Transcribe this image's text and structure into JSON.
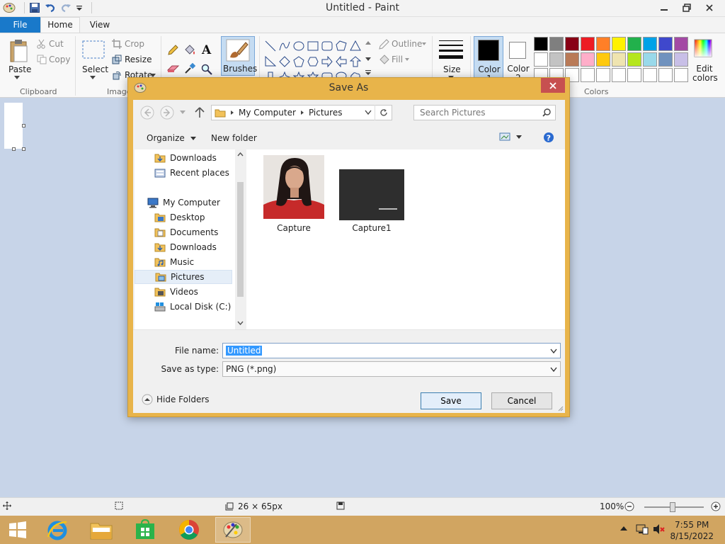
{
  "app": {
    "title": "Untitled - Paint",
    "tabs": {
      "file": "File",
      "home": "Home",
      "view": "View"
    }
  },
  "ribbon": {
    "clipboard": {
      "paste": "Paste",
      "cut": "Cut",
      "copy": "Copy",
      "group": "Clipboard"
    },
    "image": {
      "select": "Select",
      "crop": "Crop",
      "resize": "Resize",
      "rotate": "Rotate",
      "group": "Image"
    },
    "brushes": "Brushes",
    "shapes": {
      "outline": "Outline",
      "fill": "Fill"
    },
    "size": "Size",
    "color1": "Color 1",
    "color2": "Color 2",
    "edit_colors": "Edit colors",
    "colors_group": "Colors",
    "palette_row1": [
      "#000000",
      "#7f7f7f",
      "#880015",
      "#ed1c24",
      "#ff7f27",
      "#fff200",
      "#22b14c",
      "#00a2e8",
      "#3f48cc",
      "#a349a4"
    ],
    "palette_row2": [
      "#ffffff",
      "#c3c3c3",
      "#b97a57",
      "#ffaec9",
      "#ffc90e",
      "#efe4b0",
      "#b5e61d",
      "#99d9ea",
      "#7092be",
      "#c8bfe7"
    ],
    "palette_row3": [
      "#ffffff",
      "#ffffff",
      "#ffffff",
      "#ffffff",
      "#ffffff",
      "#ffffff",
      "#ffffff",
      "#ffffff",
      "#ffffff",
      "#ffffff"
    ]
  },
  "dialog": {
    "title": "Save As",
    "breadcrumb": [
      "My Computer",
      "Pictures"
    ],
    "search_placeholder": "Search Pictures",
    "organize": "Organize",
    "new_folder": "New folder",
    "nav": {
      "downloads_top": "Downloads",
      "recent_places": "Recent places",
      "my_computer": "My Computer",
      "desktop": "Desktop",
      "documents": "Documents",
      "downloads": "Downloads",
      "music": "Music",
      "pictures": "Pictures",
      "videos": "Videos",
      "local_disk": "Local Disk (C:)"
    },
    "files": [
      "Capture",
      "Capture1"
    ],
    "file_name_label": "File name:",
    "file_name_value": "Untitled",
    "save_type_label": "Save as type:",
    "save_type_value": "PNG (*.png)",
    "hide_folders": "Hide Folders",
    "save": "Save",
    "cancel": "Cancel"
  },
  "status": {
    "dimensions": "26 × 65px",
    "zoom": "100%",
    "zoom_level_percent": 100
  },
  "taskbar": {
    "time": "7:55 PM",
    "date": "8/15/2022"
  }
}
